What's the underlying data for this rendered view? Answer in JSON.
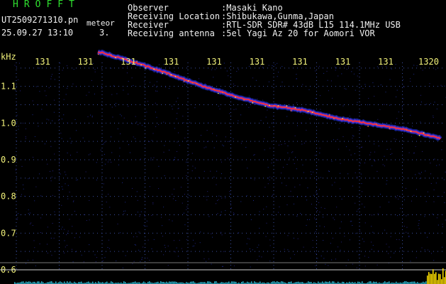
{
  "header": {
    "app_title": "HROFFT",
    "file_name": "UT2509271310.pn",
    "file_ext": "meteor",
    "date_time": "25.09.27 13:10",
    "channel": "3.",
    "info": [
      {
        "label": "Observer",
        "value": ":Masaki Kano"
      },
      {
        "label": "Receiving Location",
        "value": ":Shibukawa,Gunma,Japan"
      },
      {
        "label": "Receiver",
        "value": ":RTL-SDR SDR# 43dB L15 114.1MHz USB"
      },
      {
        "label": "Receiving antenna",
        "value": ":5el Yagi Az 20 for Aomori VOR"
      }
    ]
  },
  "colors": {
    "background": "#000000",
    "header_green": "#2fe02f",
    "header_white": "#f2f2f2",
    "tick_yellow": "#f2f27a",
    "grid_dot": "#3a4ea0",
    "trace_core": "#ff3030",
    "trace_halo": "#2a3cff"
  },
  "chart_data": {
    "type": "spectrogram",
    "unit_label": "kHz",
    "x_tick_labels": [
      "131",
      "131",
      "131",
      "131",
      "131",
      "131",
      "131",
      "131",
      "131",
      "1320"
    ],
    "y_tick_labels": [
      "1.1",
      "1.0",
      "0.9",
      "0.8",
      "0.7",
      "0.6"
    ],
    "y_ticks": [
      1.1,
      1.0,
      0.9,
      0.8,
      0.7,
      0.6
    ],
    "ylim": [
      0.6,
      1.2
    ],
    "trace": {
      "x_frac": [
        0.0,
        0.1,
        0.2,
        0.3,
        0.4,
        0.5,
        0.6,
        0.7,
        0.8,
        0.9,
        1.0
      ],
      "freq_khz": [
        1.195,
        1.168,
        1.137,
        1.103,
        1.073,
        1.048,
        1.035,
        1.012,
        0.998,
        0.982,
        0.958
      ]
    }
  }
}
